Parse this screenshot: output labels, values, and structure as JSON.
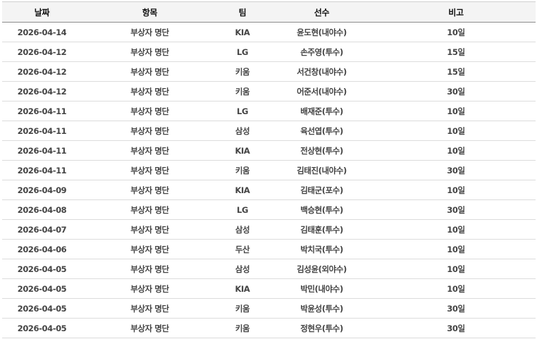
{
  "table": {
    "headers": [
      "날짜",
      "항목",
      "팀",
      "선수",
      "비고"
    ],
    "rows": [
      [
        "2026-04-14",
        "부상자 명단",
        "KIA",
        "윤도현(내야수)",
        "10일"
      ],
      [
        "2026-04-12",
        "부상자 명단",
        "LG",
        "손주영(투수)",
        "15일"
      ],
      [
        "2026-04-12",
        "부상자 명단",
        "키움",
        "서건창(내야수)",
        "15일"
      ],
      [
        "2026-04-12",
        "부상자 명단",
        "키움",
        "어준서(내야수)",
        "30일"
      ],
      [
        "2026-04-11",
        "부상자 명단",
        "LG",
        "배재준(투수)",
        "10일"
      ],
      [
        "2026-04-11",
        "부상자 명단",
        "삼성",
        "육선엽(투수)",
        "10일"
      ],
      [
        "2026-04-11",
        "부상자 명단",
        "KIA",
        "전상현(투수)",
        "10일"
      ],
      [
        "2026-04-11",
        "부상자 명단",
        "키움",
        "김태진(내야수)",
        "30일"
      ],
      [
        "2026-04-09",
        "부상자 명단",
        "KIA",
        "김태군(포수)",
        "10일"
      ],
      [
        "2026-04-08",
        "부상자 명단",
        "LG",
        "백승현(투수)",
        "30일"
      ],
      [
        "2026-04-07",
        "부상자 명단",
        "삼성",
        "김태훈(투수)",
        "10일"
      ],
      [
        "2026-04-06",
        "부상자 명단",
        "두산",
        "박치국(투수)",
        "10일"
      ],
      [
        "2026-04-05",
        "부상자 명단",
        "삼성",
        "김성윤(외야수)",
        "10일"
      ],
      [
        "2026-04-05",
        "부상자 명단",
        "KIA",
        "박민(내야수)",
        "10일"
      ],
      [
        "2026-04-05",
        "부상자 명단",
        "키움",
        "박윤성(투수)",
        "30일"
      ],
      [
        "2026-04-05",
        "부상자 명단",
        "키움",
        "정현우(투수)",
        "30일"
      ]
    ]
  }
}
